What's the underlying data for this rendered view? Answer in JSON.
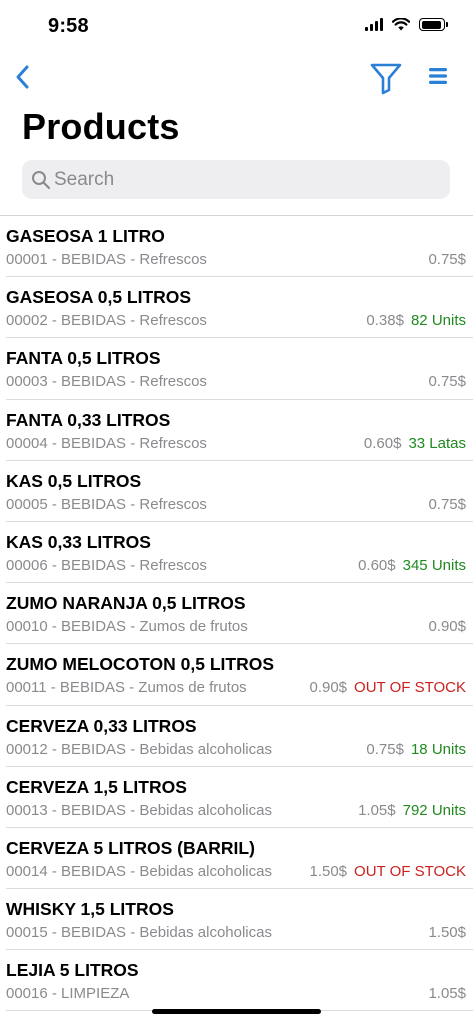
{
  "status_bar": {
    "time": "9:58"
  },
  "nav": {
    "back_icon": "chevron-left-icon",
    "filter_icon": "filter-icon",
    "menu_icon": "list-menu-icon",
    "accent_color": "#2a7fd6"
  },
  "page": {
    "title": "Products"
  },
  "search": {
    "placeholder": "Search",
    "value": ""
  },
  "colors": {
    "in_stock": "#1f8a1f",
    "out_of_stock": "#cc1f1f",
    "secondary": "#8a8a8e"
  },
  "products": [
    {
      "name": "GASEOSA 1 LITRO",
      "meta": "00001 - BEBIDAS - Refrescos",
      "price": "0.75$",
      "stock": "",
      "stock_status": "none"
    },
    {
      "name": "GASEOSA 0,5 LITROS",
      "meta": "00002 - BEBIDAS - Refrescos",
      "price": "0.38$",
      "stock": "82 Units",
      "stock_status": "in"
    },
    {
      "name": "FANTA 0,5 LITROS",
      "meta": "00003 - BEBIDAS - Refrescos",
      "price": "0.75$",
      "stock": "",
      "stock_status": "none"
    },
    {
      "name": "FANTA 0,33 LITROS",
      "meta": "00004 - BEBIDAS - Refrescos",
      "price": "0.60$",
      "stock": "33 Latas",
      "stock_status": "in"
    },
    {
      "name": "KAS 0,5 LITROS",
      "meta": "00005 - BEBIDAS - Refrescos",
      "price": "0.75$",
      "stock": "",
      "stock_status": "none"
    },
    {
      "name": "KAS 0,33 LITROS",
      "meta": "00006 - BEBIDAS - Refrescos",
      "price": "0.60$",
      "stock": "345 Units",
      "stock_status": "in"
    },
    {
      "name": "ZUMO NARANJA 0,5 LITROS",
      "meta": "00010 - BEBIDAS - Zumos de frutos",
      "price": "0.90$",
      "stock": "",
      "stock_status": "none"
    },
    {
      "name": "ZUMO MELOCOTON 0,5 LITROS",
      "meta": "00011 - BEBIDAS - Zumos de frutos",
      "price": "0.90$",
      "stock": "OUT OF STOCK",
      "stock_status": "out"
    },
    {
      "name": "CERVEZA 0,33 LITROS",
      "meta": "00012 - BEBIDAS - Bebidas alcoholicas",
      "price": "0.75$",
      "stock": "18 Units",
      "stock_status": "in"
    },
    {
      "name": "CERVEZA 1,5 LITROS",
      "meta": "00013 - BEBIDAS - Bebidas alcoholicas",
      "price": "1.05$",
      "stock": "792 Units",
      "stock_status": "in"
    },
    {
      "name": "CERVEZA 5 LITROS (BARRIL)",
      "meta": "00014 - BEBIDAS - Bebidas alcoholicas",
      "price": "1.50$",
      "stock": "OUT OF STOCK",
      "stock_status": "out"
    },
    {
      "name": "WHISKY 1,5 LITROS",
      "meta": "00015 - BEBIDAS - Bebidas alcoholicas",
      "price": "1.50$",
      "stock": "",
      "stock_status": "none"
    },
    {
      "name": "LEJIA 5 LITROS",
      "meta": "00016 - LIMPIEZA",
      "price": "1.05$",
      "stock": "",
      "stock_status": "none"
    }
  ]
}
